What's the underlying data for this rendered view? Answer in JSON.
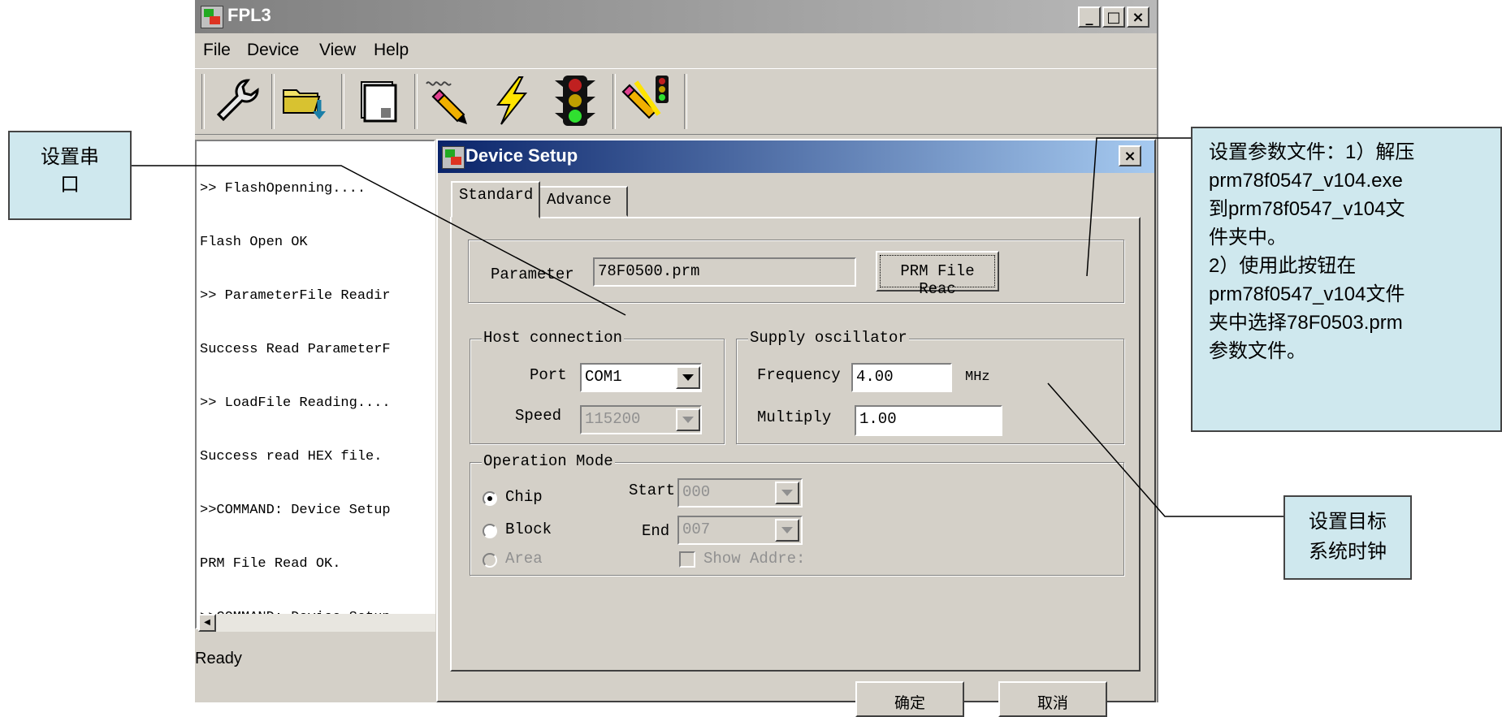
{
  "main_window": {
    "title": "FPL3",
    "caption_buttons": [
      "_",
      "□",
      "×"
    ],
    "menu": [
      "File",
      "Device",
      "View",
      "Help"
    ],
    "toolbar": [
      {
        "icon": "wrench-icon"
      },
      {
        "icon": "folder-load-icon"
      },
      {
        "icon": "blank-page-icon"
      },
      {
        "icon": "erase-pencil-icon"
      },
      {
        "icon": "lightning-icon"
      },
      {
        "icon": "traffic-light-icon"
      },
      {
        "icon": "auto-program-icon"
      }
    ],
    "log_lines": [
      ">> FlashOpenning....",
      "Flash Open OK",
      ">> ParameterFile Readir",
      "Success Read ParameterF",
      ">> LoadFile Reading....",
      "Success read HEX file.",
      ">>COMMAND: Device Setup",
      "PRM File Read OK.",
      ">>COMMAND: Device Setup"
    ],
    "status": "Ready"
  },
  "dialog": {
    "title": "Device Setup",
    "close": "×",
    "tabs": [
      "Standard",
      "Advance"
    ],
    "parameter": {
      "label": "Parameter",
      "value": "78F0500.prm",
      "button": "PRM File Reac"
    },
    "host_connection": {
      "legend": "Host connection",
      "port_label": "Port",
      "port_value": "COM1",
      "speed_label": "Speed",
      "speed_value": "115200"
    },
    "supply_oscillator": {
      "legend": "Supply oscillator",
      "frequency_label": "Frequency",
      "frequency_value": "4.00",
      "frequency_unit": "MHz",
      "multiply_label": "Multiply",
      "multiply_value": "1.00"
    },
    "operation_mode": {
      "legend": "Operation Mode",
      "chip": "Chip",
      "block": "Block",
      "area": "Area",
      "start_label": "Start",
      "start_value": "000",
      "end_label": "End",
      "end_value": "007",
      "show_address": "Show Addre:"
    },
    "ok_button": "确定",
    "cancel_button": "取消"
  },
  "callouts": {
    "port": [
      "设置串",
      "口"
    ],
    "param": [
      "设置参数文件：1）解压",
      "prm78f0547_v104.exe",
      "到prm78f0547_v104文",
      "件夹中。",
      "2）使用此按钮在",
      "prm78f0547_v104文件",
      "夹中选择78F0503.prm",
      "参数文件。"
    ],
    "clock": [
      "设置目标",
      "系统时钟"
    ]
  }
}
